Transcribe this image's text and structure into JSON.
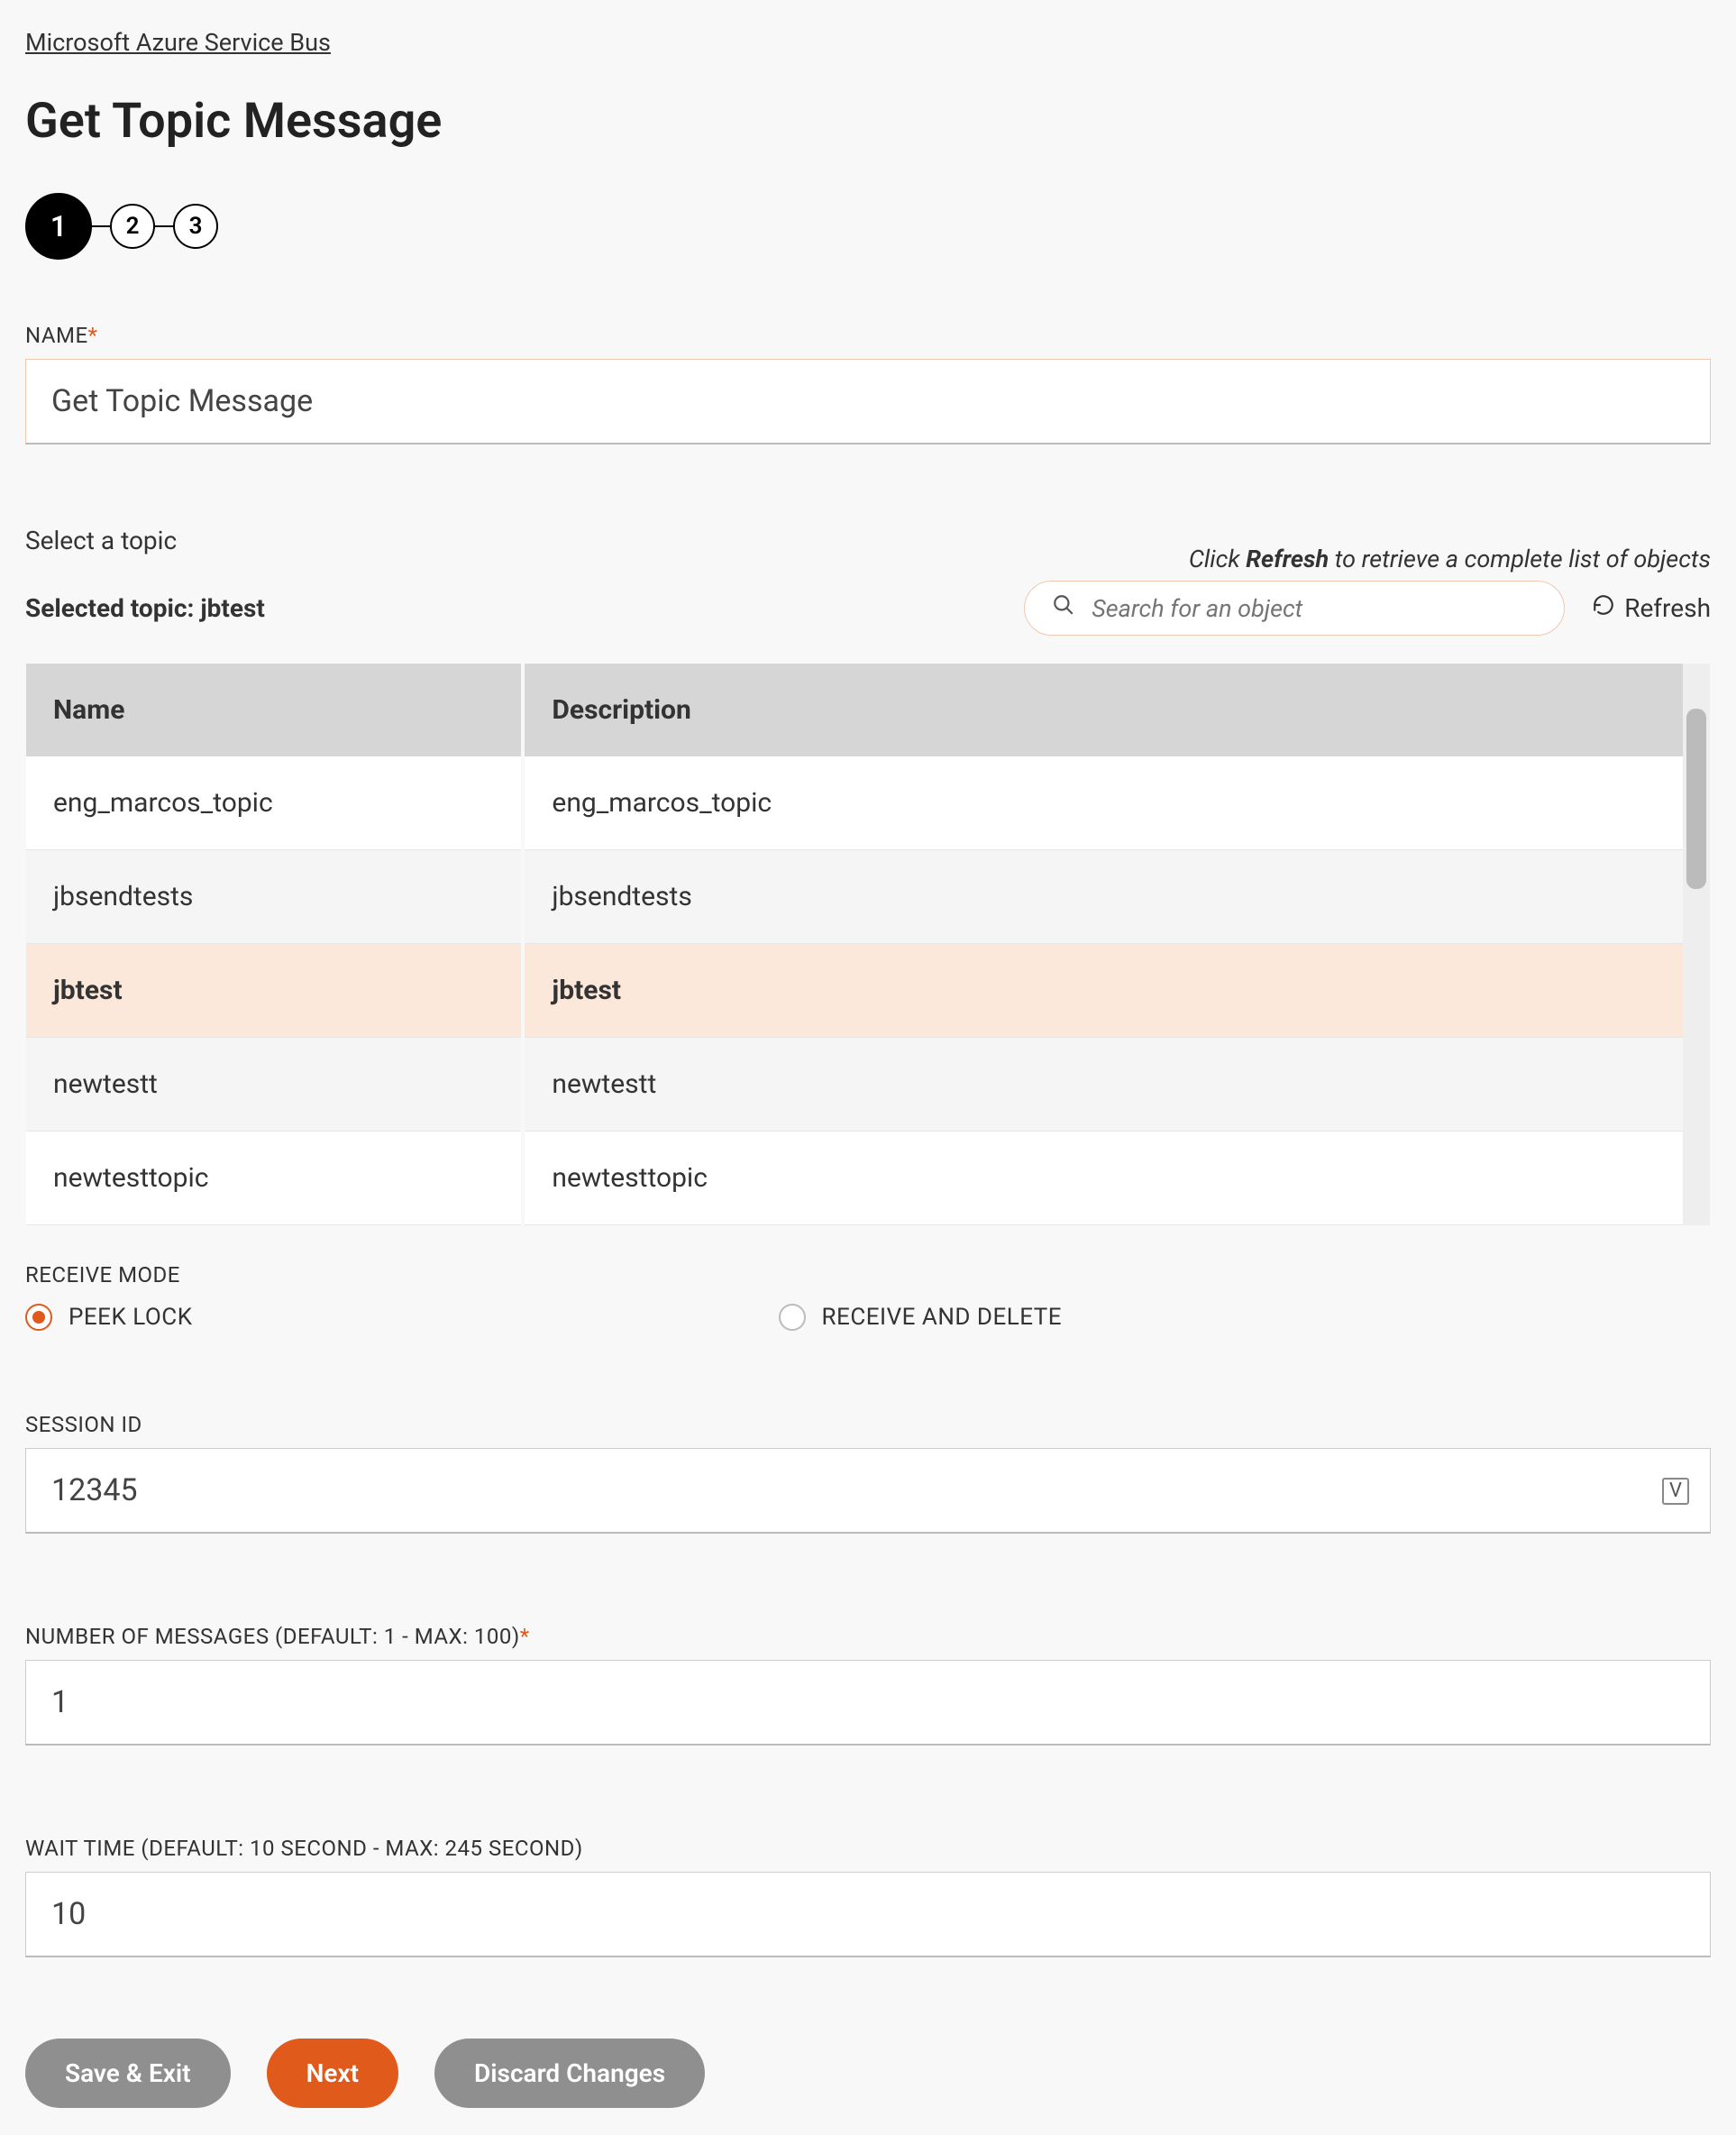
{
  "breadcrumb": "Microsoft Azure Service Bus",
  "title": "Get Topic Message",
  "stepper": {
    "steps": [
      "1",
      "2",
      "3"
    ],
    "active_index": 0
  },
  "fields": {
    "name": {
      "label": "NAME",
      "value": "Get Topic Message"
    }
  },
  "topic_picker": {
    "select_label": "Select a topic",
    "hint_prefix": "Click ",
    "hint_bold": "Refresh",
    "hint_suffix": " to retrieve a complete list of objects",
    "selected_prefix": "Selected topic: ",
    "selected_value": "jbtest",
    "search_placeholder": "Search for an object",
    "refresh_label": "Refresh",
    "columns": {
      "name": "Name",
      "description": "Description"
    },
    "rows": [
      {
        "name": "eng_marcos_topic",
        "description": "eng_marcos_topic",
        "selected": false
      },
      {
        "name": "jbsendtests",
        "description": "jbsendtests",
        "selected": false
      },
      {
        "name": "jbtest",
        "description": "jbtest",
        "selected": true
      },
      {
        "name": "newtestt",
        "description": "newtestt",
        "selected": false
      },
      {
        "name": "newtesttopic",
        "description": "newtesttopic",
        "selected": false
      }
    ]
  },
  "receive_mode": {
    "label": "RECEIVE MODE",
    "options": [
      {
        "key": "peek_lock",
        "label": "PEEK LOCK",
        "checked": true
      },
      {
        "key": "receive_and_delete",
        "label": "RECEIVE AND DELETE",
        "checked": false
      }
    ]
  },
  "session_id": {
    "label": "SESSION ID",
    "value": "12345"
  },
  "num_messages": {
    "label": "NUMBER OF MESSAGES (DEFAULT: 1 - MAX: 100)",
    "value": "1"
  },
  "wait_time": {
    "label": "WAIT TIME (DEFAULT: 10 SECOND - MAX: 245 SECOND)",
    "value": "10"
  },
  "footer": {
    "save_exit": "Save & Exit",
    "next": "Next",
    "discard": "Discard Changes"
  }
}
